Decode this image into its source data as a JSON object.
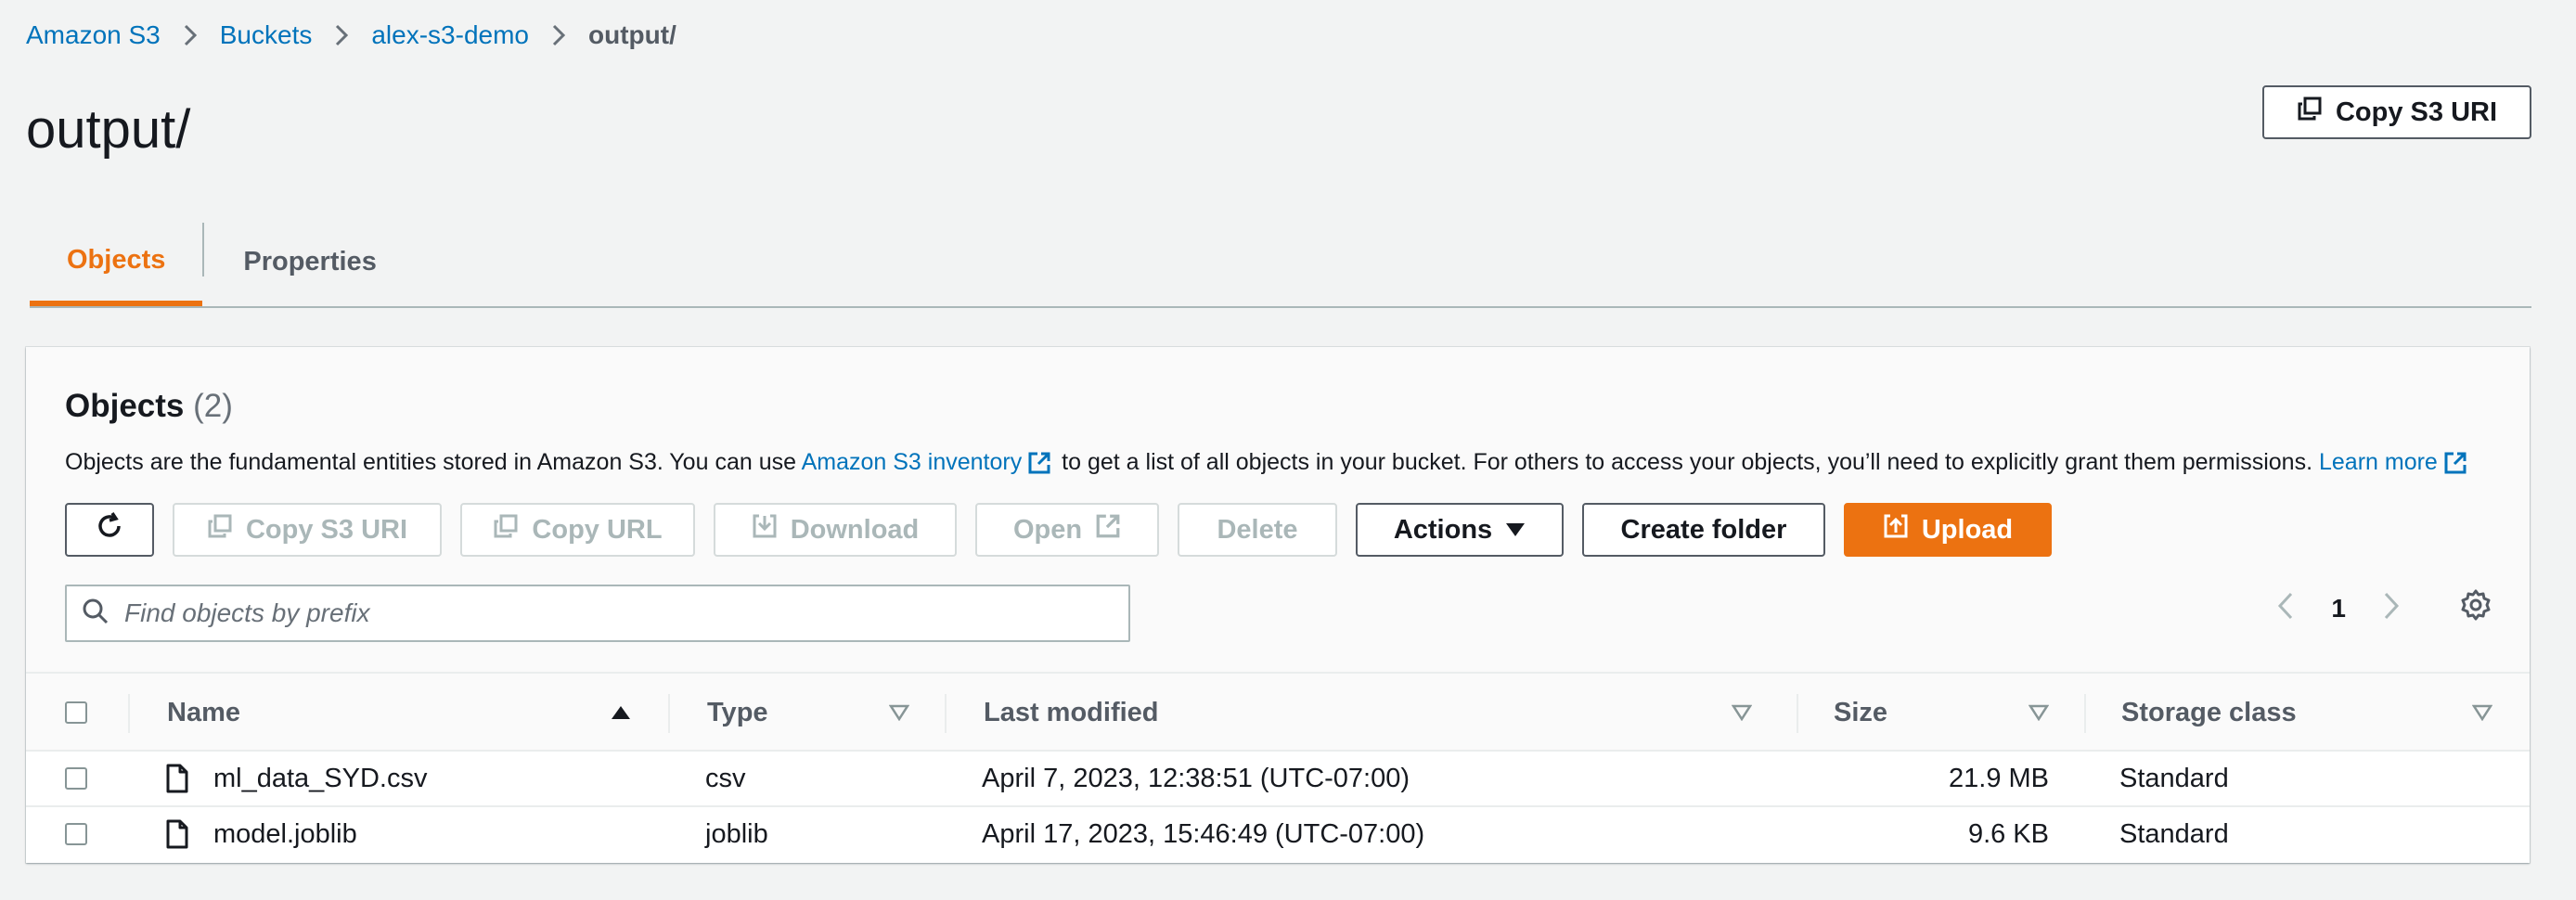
{
  "breadcrumb": [
    "Amazon S3",
    "Buckets",
    "alex-s3-demo",
    "output/"
  ],
  "page_title": "output/",
  "header_copy_uri": "Copy S3 URI",
  "tabs": [
    "Objects",
    "Properties"
  ],
  "objects": {
    "title": "Objects",
    "count": "(2)",
    "desc_1": "Objects are the fundamental entities stored in Amazon S3. You can use",
    "inventory_link": "Amazon S3 inventory",
    "desc_2": "to get a list of all objects in your bucket. For others to access your objects, you’ll need to explicitly grant them permissions.",
    "learn_more": "Learn more"
  },
  "toolbar": {
    "copy_uri": "Copy S3 URI",
    "copy_url": "Copy URL",
    "download": "Download",
    "open": "Open",
    "delete": "Delete",
    "actions": "Actions",
    "create_folder": "Create folder",
    "upload": "Upload"
  },
  "search": {
    "placeholder": "Find objects by prefix"
  },
  "pagination": {
    "page": "1"
  },
  "table": {
    "columns": [
      "Name",
      "Type",
      "Last modified",
      "Size",
      "Storage class"
    ],
    "rows": [
      {
        "name": "ml_data_SYD.csv",
        "type": "csv",
        "modified": "April 7, 2023, 12:38:51 (UTC-07:00)",
        "size": "21.9 MB",
        "storage": "Standard"
      },
      {
        "name": "model.joblib",
        "type": "joblib",
        "modified": "April 17, 2023, 15:46:49 (UTC-07:00)",
        "size": "9.6 KB",
        "storage": "Standard"
      }
    ]
  },
  "colors": {
    "accent": "#ec7211",
    "link": "#0073bb",
    "text": "#16191f",
    "muted": "#545b64"
  },
  "icons": [
    "chevron-right-icon",
    "copy-icon",
    "refresh-icon",
    "download-icon",
    "external-link-icon",
    "caret-down-icon",
    "upload-icon",
    "search-icon",
    "chevron-left-icon",
    "gear-icon",
    "sort-asc-icon",
    "sort-icon",
    "file-icon"
  ]
}
